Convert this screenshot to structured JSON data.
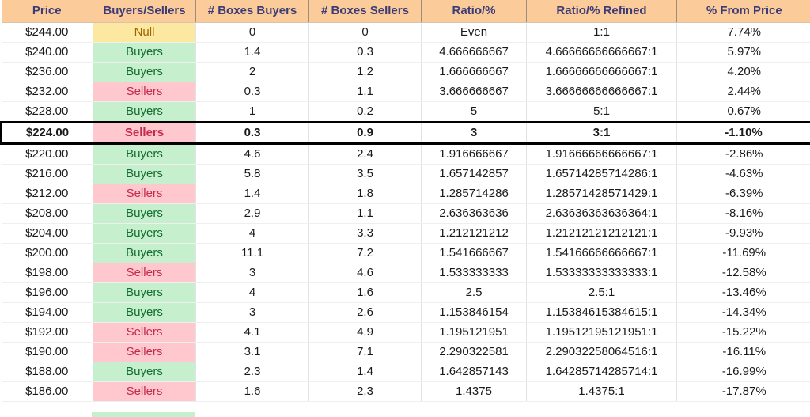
{
  "table": {
    "columns": [
      "Price",
      "Buyers/Sellers",
      "# Boxes Buyers",
      "# Boxes Sellers",
      "Ratio/%",
      "Ratio/% Refined",
      "% From Price"
    ],
    "highlighted_row_price": "$224.00",
    "colors": {
      "header_bg": "#FCCB9A",
      "header_text": "#3B3B76",
      "buyers_bg": "#C6EFCE",
      "buyers_text": "#146C2E",
      "sellers_bg": "#FFC7CE",
      "sellers_text": "#C42B4A",
      "null_bg": "#FCE8A0",
      "null_text": "#9C6500",
      "highlight_border": "#000000"
    },
    "rows": [
      {
        "price": "$244.00",
        "side": "Null",
        "boxes_buyers": "0",
        "boxes_sellers": "0",
        "ratio": "Even",
        "ratio_refined": "1:1",
        "pct_from_price": "7.74%"
      },
      {
        "price": "$240.00",
        "side": "Buyers",
        "boxes_buyers": "1.4",
        "boxes_sellers": "0.3",
        "ratio": "4.666666667",
        "ratio_refined": "4.66666666666667:1",
        "pct_from_price": "5.97%"
      },
      {
        "price": "$236.00",
        "side": "Buyers",
        "boxes_buyers": "2",
        "boxes_sellers": "1.2",
        "ratio": "1.666666667",
        "ratio_refined": "1.66666666666667:1",
        "pct_from_price": "4.20%"
      },
      {
        "price": "$232.00",
        "side": "Sellers",
        "boxes_buyers": "0.3",
        "boxes_sellers": "1.1",
        "ratio": "3.666666667",
        "ratio_refined": "3.66666666666667:1",
        "pct_from_price": "2.44%"
      },
      {
        "price": "$228.00",
        "side": "Buyers",
        "boxes_buyers": "1",
        "boxes_sellers": "0.2",
        "ratio": "5",
        "ratio_refined": "5:1",
        "pct_from_price": "0.67%"
      },
      {
        "price": "$224.00",
        "side": "Sellers",
        "boxes_buyers": "0.3",
        "boxes_sellers": "0.9",
        "ratio": "3",
        "ratio_refined": "3:1",
        "pct_from_price": "-1.10%"
      },
      {
        "price": "$220.00",
        "side": "Buyers",
        "boxes_buyers": "4.6",
        "boxes_sellers": "2.4",
        "ratio": "1.916666667",
        "ratio_refined": "1.91666666666667:1",
        "pct_from_price": "-2.86%"
      },
      {
        "price": "$216.00",
        "side": "Buyers",
        "boxes_buyers": "5.8",
        "boxes_sellers": "3.5",
        "ratio": "1.657142857",
        "ratio_refined": "1.65714285714286:1",
        "pct_from_price": "-4.63%"
      },
      {
        "price": "$212.00",
        "side": "Sellers",
        "boxes_buyers": "1.4",
        "boxes_sellers": "1.8",
        "ratio": "1.285714286",
        "ratio_refined": "1.28571428571429:1",
        "pct_from_price": "-6.39%"
      },
      {
        "price": "$208.00",
        "side": "Buyers",
        "boxes_buyers": "2.9",
        "boxes_sellers": "1.1",
        "ratio": "2.636363636",
        "ratio_refined": "2.63636363636364:1",
        "pct_from_price": "-8.16%"
      },
      {
        "price": "$204.00",
        "side": "Buyers",
        "boxes_buyers": "4",
        "boxes_sellers": "3.3",
        "ratio": "1.212121212",
        "ratio_refined": "1.21212121212121:1",
        "pct_from_price": "-9.93%"
      },
      {
        "price": "$200.00",
        "side": "Buyers",
        "boxes_buyers": "11.1",
        "boxes_sellers": "7.2",
        "ratio": "1.541666667",
        "ratio_refined": "1.54166666666667:1",
        "pct_from_price": "-11.69%"
      },
      {
        "price": "$198.00",
        "side": "Sellers",
        "boxes_buyers": "3",
        "boxes_sellers": "4.6",
        "ratio": "1.533333333",
        "ratio_refined": "1.53333333333333:1",
        "pct_from_price": "-12.58%"
      },
      {
        "price": "$196.00",
        "side": "Buyers",
        "boxes_buyers": "4",
        "boxes_sellers": "1.6",
        "ratio": "2.5",
        "ratio_refined": "2.5:1",
        "pct_from_price": "-13.46%"
      },
      {
        "price": "$194.00",
        "side": "Buyers",
        "boxes_buyers": "3",
        "boxes_sellers": "2.6",
        "ratio": "1.153846154",
        "ratio_refined": "1.15384615384615:1",
        "pct_from_price": "-14.34%"
      },
      {
        "price": "$192.00",
        "side": "Sellers",
        "boxes_buyers": "4.1",
        "boxes_sellers": "4.9",
        "ratio": "1.195121951",
        "ratio_refined": "1.19512195121951:1",
        "pct_from_price": "-15.22%"
      },
      {
        "price": "$190.00",
        "side": "Sellers",
        "boxes_buyers": "3.1",
        "boxes_sellers": "7.1",
        "ratio": "2.290322581",
        "ratio_refined": "2.29032258064516:1",
        "pct_from_price": "-16.11%"
      },
      {
        "price": "$188.00",
        "side": "Buyers",
        "boxes_buyers": "2.3",
        "boxes_sellers": "1.4",
        "ratio": "1.642857143",
        "ratio_refined": "1.64285714285714:1",
        "pct_from_price": "-16.99%"
      },
      {
        "price": "$186.00",
        "side": "Sellers",
        "boxes_buyers": "1.6",
        "boxes_sellers": "2.3",
        "ratio": "1.4375",
        "ratio_refined": "1.4375:1",
        "pct_from_price": "-17.87%"
      }
    ]
  }
}
